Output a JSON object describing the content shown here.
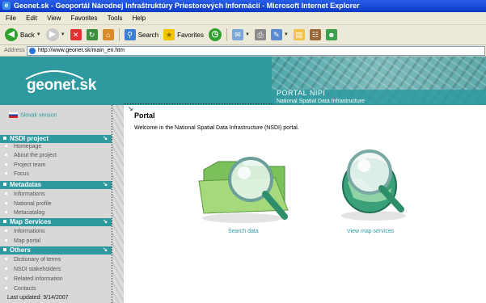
{
  "window": {
    "title": "Geonet.sk - Geoportál Národnej Infraštruktúry Priestorových Informácií - Microsoft Internet Explorer"
  },
  "menu": [
    "File",
    "Edit",
    "View",
    "Favorites",
    "Tools",
    "Help"
  ],
  "toolbar": {
    "back_label": "Back",
    "search_label": "Search",
    "favorites_label": "Favorites"
  },
  "address": {
    "label": "Address",
    "url": "http://www.geonet.sk/main_en.htm"
  },
  "banner": {
    "logo": "geonet.sk",
    "portal_title": "PORTAL NIPI",
    "portal_subtitle": "National Spatial Data Infrastructure"
  },
  "sidebar": {
    "slovak_version": "Slovak version",
    "sections": [
      {
        "title": "NSDI project",
        "items": [
          "Homepage",
          "About the project",
          "Project team",
          "Focus"
        ]
      },
      {
        "title": "Metadatas",
        "items": [
          "Informations",
          "National profile",
          "Metacatalog"
        ]
      },
      {
        "title": "Map Services",
        "items": [
          "Informations",
          "Map portal"
        ]
      },
      {
        "title": "Others",
        "items": [
          "Dictionary of terms",
          "NSDI stakeholders",
          "Related information",
          "Contacts"
        ]
      }
    ],
    "last_updated": "Last updated: 9/14/2007"
  },
  "content": {
    "title": "Portal",
    "welcome": "Welcome in the National Spatial Data Infrastructure (NSDI) portal.",
    "search_data": "Search data",
    "view_map_services": "View map services"
  },
  "colors": {
    "brand": "#2e9aa0",
    "sidebar_bg": "#d8d8d8"
  }
}
